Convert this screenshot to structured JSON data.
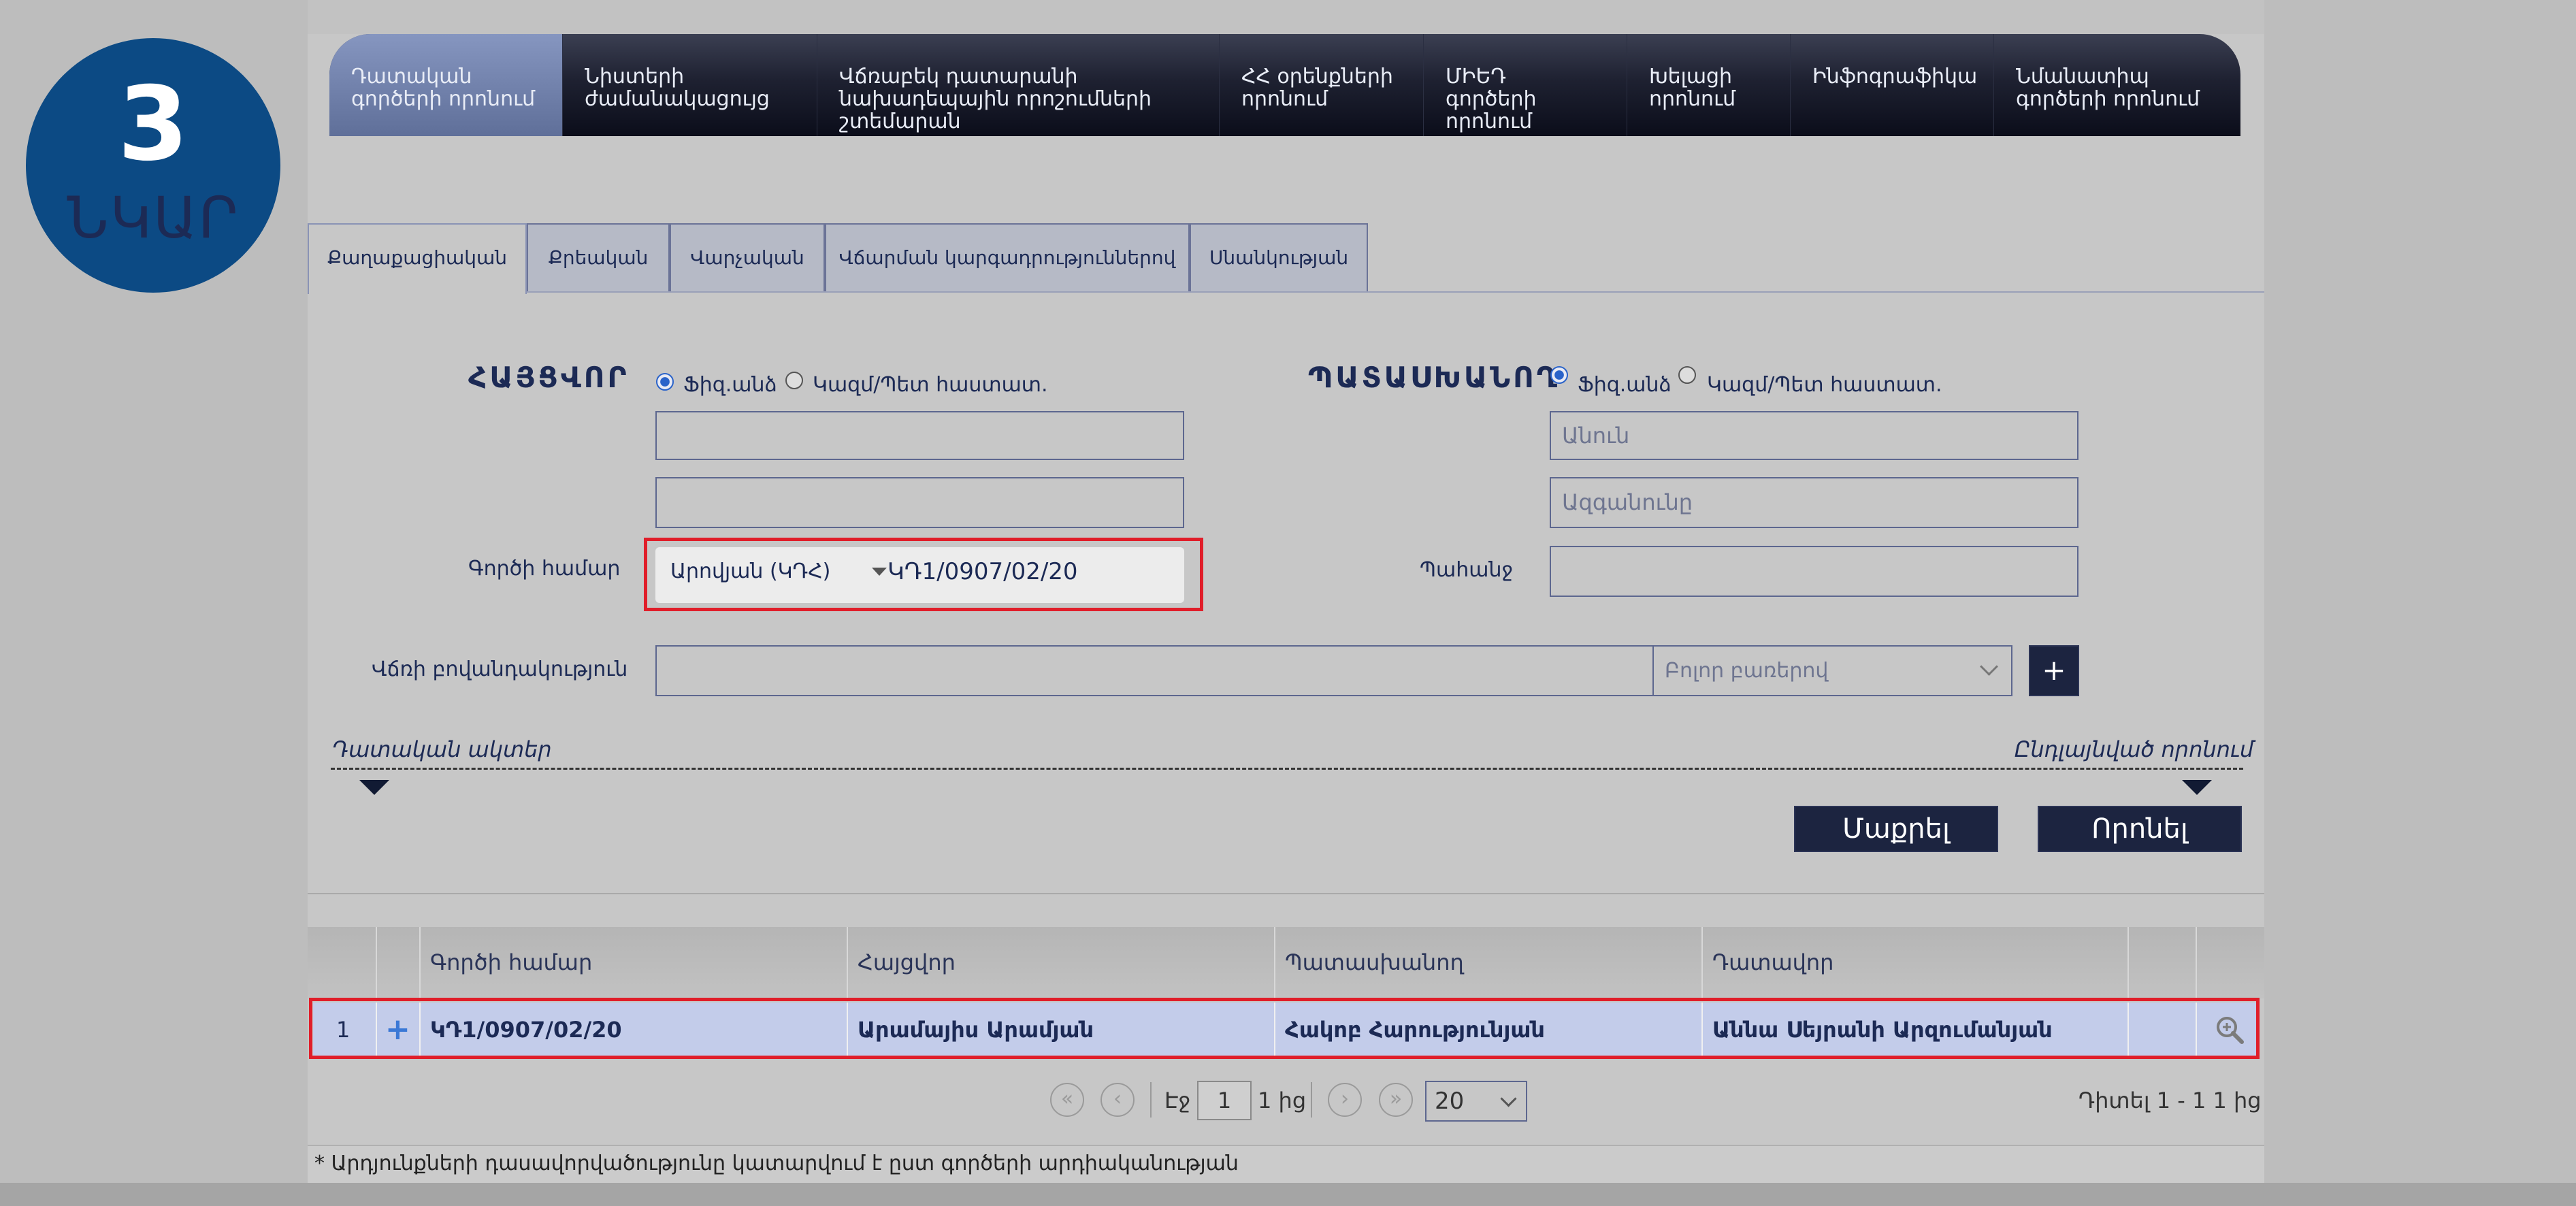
{
  "badge": {
    "number": "3",
    "label": "ՆԿԱՐ"
  },
  "nav": {
    "items": [
      {
        "lines": [
          "Դատական",
          "գործերի որոնում"
        ]
      },
      {
        "lines": [
          "Նիստերի",
          "ժամանակացույց"
        ]
      },
      {
        "lines": [
          "Վճռաբեկ դատարանի",
          "նախադեպային որոշումների",
          "շտեմարան"
        ]
      },
      {
        "lines": [
          "ՀՀ օրենքների",
          "որոնում"
        ]
      },
      {
        "lines": [
          "ՄԻԵԴ",
          "գործերի",
          "որոնում"
        ]
      },
      {
        "lines": [
          "Խելացի",
          "որոնում"
        ]
      },
      {
        "lines": [
          "Ինֆոգրաֆիկա"
        ]
      },
      {
        "lines": [
          "Նմանատիպ",
          "գործերի որոնում"
        ]
      }
    ]
  },
  "tabs": [
    "Քաղաքացիական",
    "Քրեական",
    "Վարչական",
    "Վճարման կարգադրություններով",
    "Սնանկության"
  ],
  "form": {
    "plaintiff_heading": "ՀԱՅՑՎՈՐ",
    "defendant_heading": "ՊԱՏԱՍԽԱՆՈՂ",
    "radio_physical": "Ֆիզ.անձ",
    "radio_legal": "Կազմ/Պետ հաստատ.",
    "name_placeholder": "Անուն",
    "surname_placeholder": "Ազգանունը",
    "case_number_label": "Գործի համար",
    "court_select": "Արովյան (ԿԴՀ)",
    "case_number_value": "ԿԴ1/0907/02/20",
    "claim_label": "Պահանջ",
    "content_label": "Վճռի բովանդակություն",
    "words_select": "Բոլոր բառերով",
    "plus": "+",
    "hint_left": "Դատական ակտեր",
    "hint_right": "Ընդլայնված որոնում",
    "clear_button": "Մաքրել",
    "search_button": "Որոնել"
  },
  "table": {
    "headers": [
      "Գործի համար",
      "Հայցվոր",
      "Պատասխանող",
      "Դատավոր"
    ],
    "rows": [
      {
        "index": "1",
        "case_number": "ԿԴ1/0907/02/20",
        "plaintiff": "Արամայիս Արամյան",
        "defendant": "Հակոբ Հարությունյան",
        "judge": "Աննա Սեյրանի Արզումանյան"
      }
    ]
  },
  "pagination": {
    "page_label": "Էջ",
    "page_value": "1",
    "of_label": "1 ից",
    "per_page": "20",
    "summary": "Դիտել 1 - 1 1 ից"
  },
  "footnote": "* Արդյունքների դասավորվածությունը կատարվում է ըստ գործերի արդիականության",
  "colors": {
    "accent": "#0c4a84",
    "highlight": "#e01e2a",
    "nav_dark": "#0b0d1a"
  }
}
